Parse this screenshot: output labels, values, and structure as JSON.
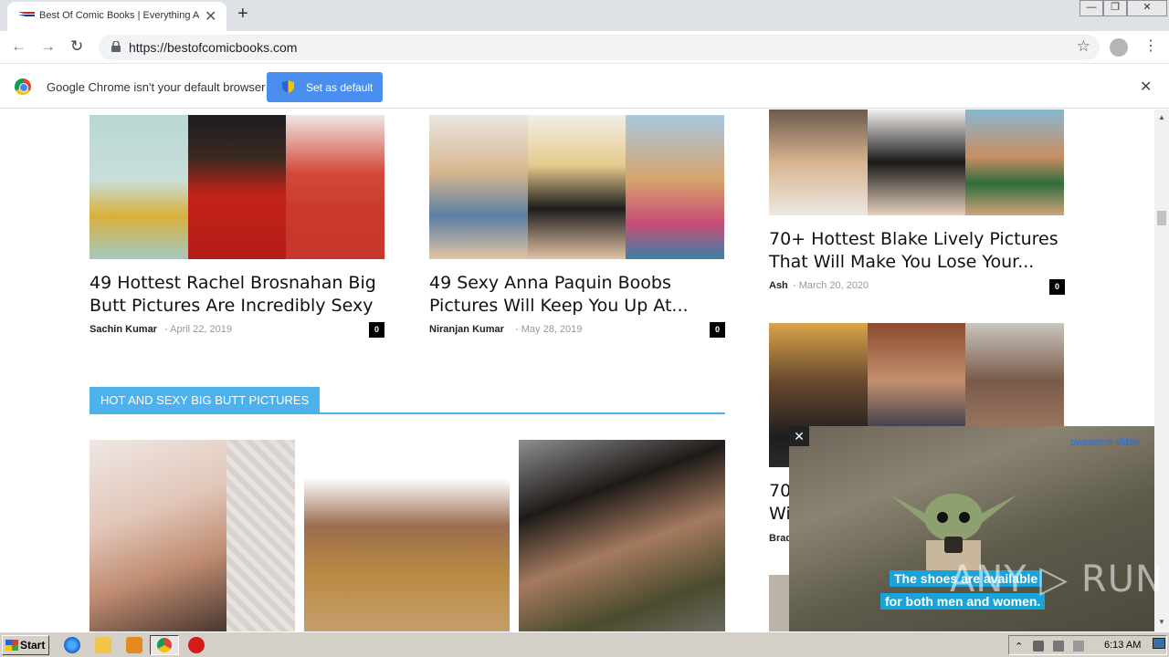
{
  "browser": {
    "tab_title": "Best Of Comic Books | Everything Ab",
    "url": "https://bestofcomicbooks.com",
    "new_tab": "+",
    "tab_close": "✕",
    "window_buttons": [
      "—",
      "❐",
      "✕"
    ]
  },
  "infobar": {
    "message": "Google Chrome isn't your default browser",
    "button_label": "Set as default",
    "close": "✕"
  },
  "articles": [
    {
      "title": "49 Hottest Rachel Brosnahan Big Butt Pictures Are Incredibly Sexy",
      "author": "Sachin Kumar",
      "date": "April 22, 2019",
      "comments": "0"
    },
    {
      "title": "49 Sexy Anna Paquin Boobs Pictures Will Keep You Up At...",
      "author": "Niranjan Kumar",
      "date": "May 28, 2019",
      "comments": "0"
    },
    {
      "title": "70+ Hottest Blake Lively Pictures That Will Make You Lose Your...",
      "author": "Ash",
      "date": "March 20, 2020",
      "comments": "0"
    },
    {
      "title_partial": "70",
      "title_partial2": "Wi",
      "author_partial": "Brad"
    }
  ],
  "section": {
    "heading": "HOT AND SEXY BIG BUTT PICTURES"
  },
  "video_ad": {
    "close": "✕",
    "brand": "awesome video",
    "caption_line1": "The shoes are available",
    "caption_line2": "for both men and women."
  },
  "watermark": "ANY ▷ RUN",
  "taskbar": {
    "start_label": "Start",
    "clock": "6:13 AM"
  }
}
